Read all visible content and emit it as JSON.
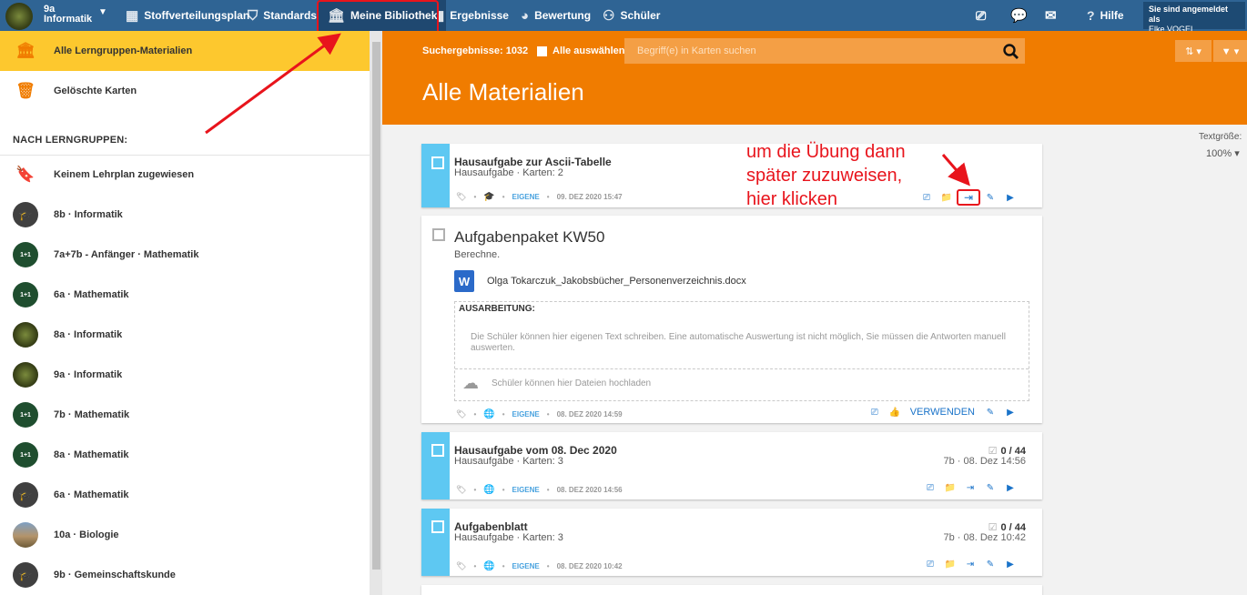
{
  "topbar": {
    "group_line1": "9a",
    "group_line2": "Informatik",
    "nav": [
      {
        "label": "Stoffverteilungsplan",
        "icon": "calendar-icon"
      },
      {
        "label": "Standards",
        "icon": "shield-icon"
      },
      {
        "label": "Meine Bibliothek",
        "icon": "library-icon"
      },
      {
        "label": "Ergebnisse",
        "icon": "bar-chart-icon"
      },
      {
        "label": "Bewertung",
        "icon": "gauge-icon"
      },
      {
        "label": "Schüler",
        "icon": "students-icon"
      }
    ],
    "help_label": "Hilfe",
    "user_line1": "Sie sind angemeldet als",
    "user_name": "Elke VOGEL"
  },
  "sidebar": {
    "all_materials": "Alle Lerngruppen-Materialien",
    "deleted_cards": "Gelöschte Karten",
    "section_title": "NACH LERNGRUPPEN:",
    "unassigned": "Keinem Lehrplan zugewiesen",
    "groups": [
      {
        "label": "8b · Informatik",
        "avatar": "dark"
      },
      {
        "label": "7a+7b - Anfänger · Mathematik",
        "avatar": "green"
      },
      {
        "label": "6a · Mathematik",
        "avatar": "green"
      },
      {
        "label": "8a · Informatik",
        "avatar": "olive"
      },
      {
        "label": "9a · Informatik",
        "avatar": "olive"
      },
      {
        "label": "7b · Mathematik",
        "avatar": "green"
      },
      {
        "label": "8a · Mathematik",
        "avatar": "green"
      },
      {
        "label": "6a · Mathematik",
        "avatar": "dark"
      },
      {
        "label": "10a · Biologie",
        "avatar": "photo"
      },
      {
        "label": "9b · Gemeinschaftskunde",
        "avatar": "dark"
      }
    ]
  },
  "main": {
    "result_count": "Suchergebnisse: 1032",
    "select_all": "Alle auswählen",
    "search_placeholder": "Begriff(e) in Karten suchen",
    "title": "Alle Materialien",
    "text_size_label": "Textgröße:",
    "text_size_value": "100%",
    "annotation": "um die Übung dann\nspäter zuzuweisen,\nhier klicken",
    "cards": [
      {
        "title": "Hausaufgabe zur Ascii-Tabelle",
        "sub": "Hausaufgabe · Karten: 2",
        "owner": "EIGENE",
        "date": "09. DEZ 2020 15:47"
      },
      {
        "title": "Aufgabenpaket KW50",
        "desc": "Berechne.",
        "file": "Olga Tokarczuk_Jakobsbücher_Personenverzeichnis.docx",
        "ausarb_title": "AUSARBEITUNG:",
        "ausarb_text": "Die Schüler können hier eigenen Text schreiben. Eine automatische Auswertung ist nicht möglich, Sie müssen die Antworten manuell auswerten.",
        "upload_text": "Schüler können hier Dateien hochladen",
        "owner": "EIGENE",
        "date": "08. DEZ 2020 14:59",
        "use_label": "VERWENDEN"
      },
      {
        "title": "Hausaufgabe vom 08. Dec 2020",
        "sub": "Hausaufgabe · Karten: 3",
        "owner": "EIGENE",
        "date": "08. DEZ 2020 14:56",
        "score": "0 / 44",
        "score_sub": "7b · 08. Dez 14:56"
      },
      {
        "title": "Aufgabenblatt",
        "sub": "Hausaufgabe · Karten: 3",
        "owner": "EIGENE",
        "date": "08. DEZ 2020 10:42",
        "score": "0 / 44",
        "score_sub": "7b · 08. Dez 10:42"
      }
    ]
  },
  "colors": {
    "topbar": "#2f6494",
    "accent_orange": "#f07c00",
    "active_yellow": "#fdc82e",
    "stripe_blue": "#5ec8f2",
    "annotation_red": "#e8141c"
  }
}
